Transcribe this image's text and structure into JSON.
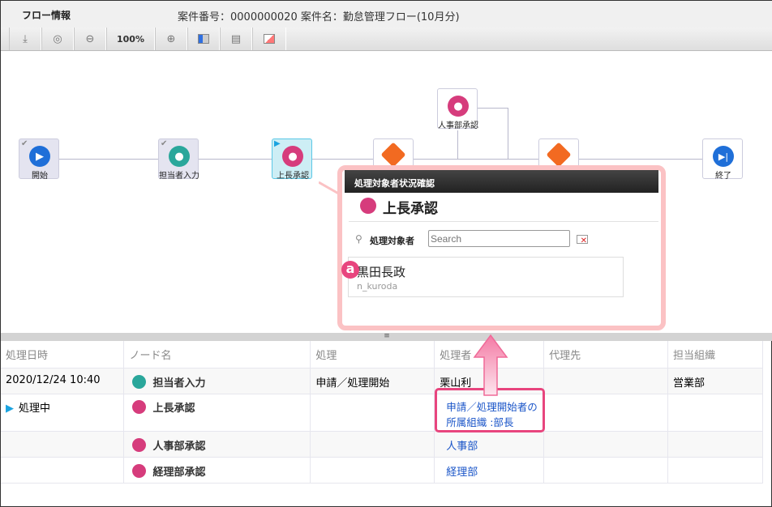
{
  "header": {
    "title": "フロー情報",
    "case_info": "案件番号：0000000020 案件名：勤怠管理フロー(10月分)"
  },
  "toolbar": {
    "items": [
      {
        "icon": "download-icon"
      },
      {
        "icon": "zoom-fit-icon"
      },
      {
        "icon": "zoom-out-icon"
      },
      {
        "label": "100%"
      },
      {
        "icon": "zoom-in-icon"
      },
      {
        "icon": "layout-icon"
      },
      {
        "icon": "table-icon"
      },
      {
        "icon": "panel-icon"
      }
    ]
  },
  "flow": {
    "nodes": [
      {
        "label": "開始",
        "type": "start",
        "status": "done",
        "color": "#1f6fd8"
      },
      {
        "label": "担当者入力",
        "type": "user",
        "status": "done",
        "color": "#2aa79b"
      },
      {
        "label": "上長承認",
        "type": "approve",
        "status": "current",
        "color": "#d63c7c"
      },
      {
        "label": "人事部承認",
        "type": "approve",
        "color": "#d63c7c"
      },
      {
        "label": "終了",
        "type": "end",
        "color": "#1f6fd8"
      }
    ]
  },
  "popup": {
    "header": "処理対象者状況確認",
    "node_title": "上長承認",
    "search_label": "処理対象者",
    "search_placeholder": "Search",
    "badge": "a",
    "user": {
      "name": "黒田長政",
      "id": "n_kuroda"
    }
  },
  "table": {
    "columns": [
      "処理日時",
      "ノード名",
      "処理",
      "処理者",
      "代理先",
      "担当組織"
    ],
    "rows": [
      {
        "date": "2020/12/24 10:40",
        "node": "担当者入力",
        "action": "申請／処理開始",
        "processor": "栗山利",
        "proxy": "",
        "org": "営業部",
        "icon_color": "#2aa79b"
      },
      {
        "date": "処理中",
        "node": "上長承認",
        "action": "",
        "processor": "申請／処理開始者の所属組織 :部長",
        "proxy": "",
        "org": "",
        "icon_color": "#d63c7c"
      },
      {
        "date": "",
        "node": "人事部承認",
        "action": "",
        "processor": "人事部",
        "proxy": "",
        "org": "",
        "icon_color": "#d63c7c"
      },
      {
        "date": "",
        "node": "経理部承認",
        "action": "",
        "processor": "経理部",
        "proxy": "",
        "org": "",
        "icon_color": "#d63c7c"
      }
    ]
  },
  "colors": {
    "highlight": "#e8457e",
    "current": "#1aa3e0"
  }
}
